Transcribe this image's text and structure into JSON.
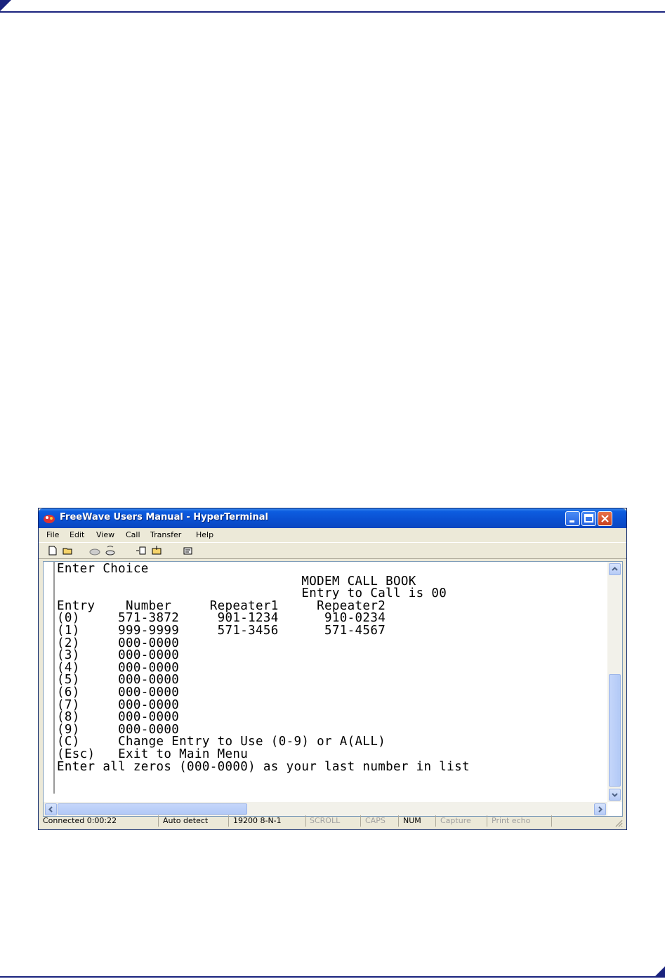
{
  "window": {
    "title": "FreeWave Users Manual - HyperTerminal"
  },
  "menu": [
    "File",
    "Edit",
    "View",
    "Call",
    "Transfer",
    "Help"
  ],
  "toolbar_icons": [
    "new-icon",
    "open-icon",
    "disconnect-icon",
    "dial-icon",
    "send-icon",
    "receive-icon",
    "properties-icon"
  ],
  "terminal": {
    "lines": [
      "Enter Choice",
      "                                MODEM CALL BOOK",
      "                                Entry to Call is 00",
      "Entry    Number     Repeater1     Repeater2",
      "(0)     571-3872     901-1234      910-0234",
      "(1)     999-9999     571-3456      571-4567",
      "(2)     000-0000",
      "(3)     000-0000",
      "(4)     000-0000",
      "(5)     000-0000",
      "(6)     000-0000",
      "(7)     000-0000",
      "(8)     000-0000",
      "(9)     000-0000",
      "(C)     Change Entry to Use (0-9) or A(ALL)",
      "(Esc)   Exit to Main Menu",
      "Enter all zeros (000-0000) as your last number in list"
    ]
  },
  "status": {
    "connected": "Connected 0:00:22",
    "detect": "Auto detect",
    "settings": "19200 8-N-1",
    "scroll": "SCROLL",
    "caps": "CAPS",
    "num": "NUM",
    "capture": "Capture",
    "print_echo": "Print echo"
  },
  "colors": {
    "rule": "#1a237e",
    "titlebar": "#0a4fd0"
  }
}
